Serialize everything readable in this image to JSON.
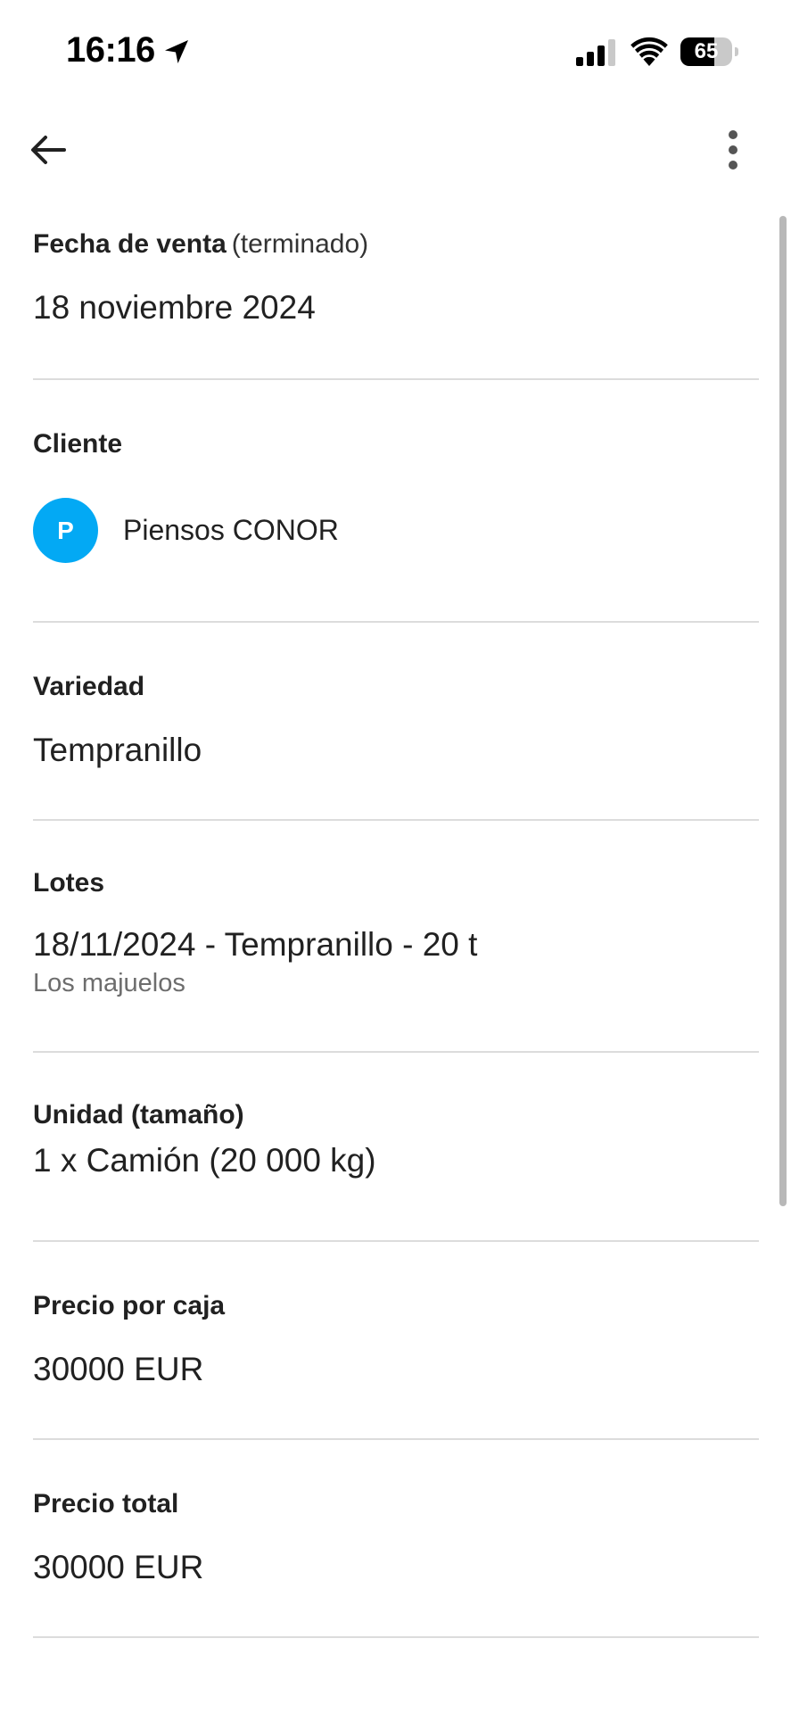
{
  "status_bar": {
    "time": "16:16",
    "battery_level": "65",
    "battery_fraction": 0.65,
    "location_icon": "location-arrow-icon",
    "signal_icon": "cellular-signal-icon",
    "wifi_icon": "wifi-icon"
  },
  "app_bar": {
    "back_icon": "arrow-left-icon",
    "more_icon": "more-vertical-icon"
  },
  "colors": {
    "accent": "#03a9f4",
    "divider": "#dcdcdc",
    "secondary_text": "#6d6d6d"
  },
  "sale": {
    "date": {
      "label": "Fecha de venta",
      "note": "(terminado)",
      "value": "18 noviembre 2024"
    },
    "client": {
      "label": "Cliente",
      "avatar_initial": "P",
      "name": "Piensos CONOR"
    },
    "variety": {
      "label": "Variedad",
      "value": "Tempranillo"
    },
    "lots": {
      "label": "Lotes",
      "value": "18/11/2024 - Tempranillo - 20 t",
      "subvalue": "Los majuelos"
    },
    "unit": {
      "label": "Unidad (tamaño)",
      "value": "1 x Camión (20 000 kg)"
    },
    "price_per_box": {
      "label": "Precio por caja",
      "value": "30000 EUR"
    },
    "total_price": {
      "label": "Precio total",
      "value": "30000 EUR"
    }
  }
}
